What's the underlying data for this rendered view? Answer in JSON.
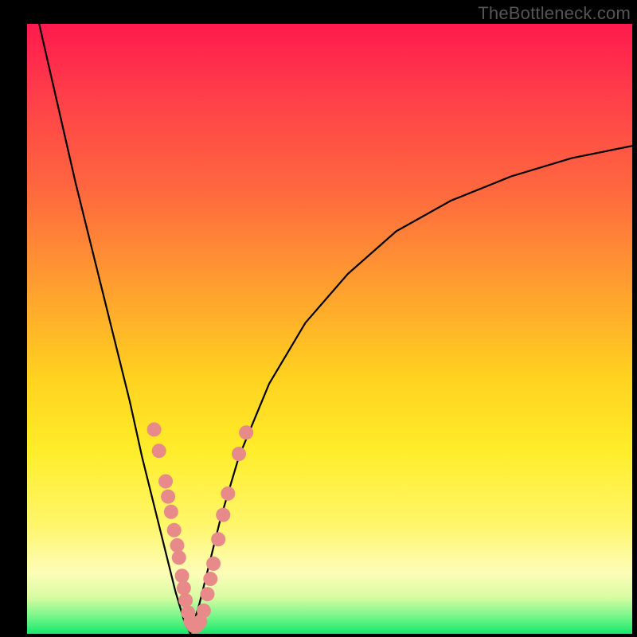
{
  "attribution": "TheBottleneck.com",
  "colors": {
    "frame": "#000000",
    "curve": "#000000",
    "marker_fill": "#e98a8a",
    "marker_stroke": "#d76f6f",
    "gradient_top": "#ff1a4d",
    "gradient_bottom": "#17e86b"
  },
  "chart_data": {
    "type": "line",
    "title": "",
    "xlabel": "",
    "ylabel": "",
    "xlim": [
      0,
      100
    ],
    "ylim": [
      0,
      100
    ],
    "series": [
      {
        "name": "left-branch",
        "x": [
          2,
          5,
          8,
          11,
          14,
          17,
          19,
          21,
          23,
          24.5,
          26,
          27
        ],
        "y": [
          100,
          87,
          74,
          62,
          50,
          38,
          29,
          21,
          13,
          7,
          2,
          0
        ]
      },
      {
        "name": "right-branch",
        "x": [
          27,
          28.5,
          30,
          32,
          35,
          40,
          46,
          53,
          61,
          70,
          80,
          90,
          100
        ],
        "y": [
          0,
          5,
          11,
          19,
          29,
          41,
          51,
          59,
          66,
          71,
          75,
          78,
          80
        ]
      }
    ],
    "markers": {
      "name": "data-points",
      "points": [
        {
          "x": 21.0,
          "y": 33.5
        },
        {
          "x": 21.8,
          "y": 30.0
        },
        {
          "x": 22.9,
          "y": 25.0
        },
        {
          "x": 23.3,
          "y": 22.5
        },
        {
          "x": 23.8,
          "y": 20.0
        },
        {
          "x": 24.3,
          "y": 17.0
        },
        {
          "x": 24.8,
          "y": 14.5
        },
        {
          "x": 25.1,
          "y": 12.5
        },
        {
          "x": 25.6,
          "y": 9.5
        },
        {
          "x": 25.9,
          "y": 7.5
        },
        {
          "x": 26.2,
          "y": 5.5
        },
        {
          "x": 26.6,
          "y": 3.5
        },
        {
          "x": 27.0,
          "y": 2.0
        },
        {
          "x": 27.5,
          "y": 1.3
        },
        {
          "x": 28.0,
          "y": 1.3
        },
        {
          "x": 28.6,
          "y": 2.0
        },
        {
          "x": 29.2,
          "y": 3.8
        },
        {
          "x": 29.8,
          "y": 6.5
        },
        {
          "x": 30.3,
          "y": 9.0
        },
        {
          "x": 30.8,
          "y": 11.5
        },
        {
          "x": 31.6,
          "y": 15.5
        },
        {
          "x": 32.4,
          "y": 19.5
        },
        {
          "x": 33.2,
          "y": 23.0
        },
        {
          "x": 35.0,
          "y": 29.5
        },
        {
          "x": 36.2,
          "y": 33.0
        }
      ]
    }
  }
}
